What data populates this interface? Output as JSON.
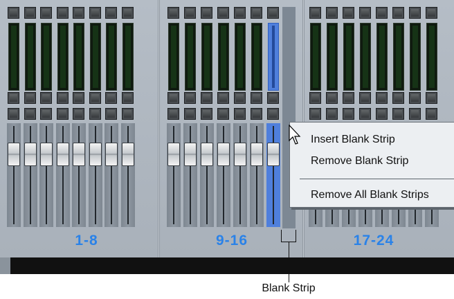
{
  "banks": [
    {
      "label": "1-8"
    },
    {
      "label": "9-16"
    },
    {
      "label": "17-24"
    }
  ],
  "context_menu": {
    "items": [
      {
        "label": "Insert Blank Strip"
      },
      {
        "label": "Remove Blank Strip"
      },
      {
        "label": "Remove All Blank Strips"
      }
    ]
  },
  "callout": {
    "label": "Blank Strip"
  },
  "colors": {
    "bank_label": "#2a82e8",
    "selected_strip": "#4f7fdc",
    "blank_strip": "#7d8894"
  },
  "icons": [
    "mouse-pointer-icon"
  ]
}
